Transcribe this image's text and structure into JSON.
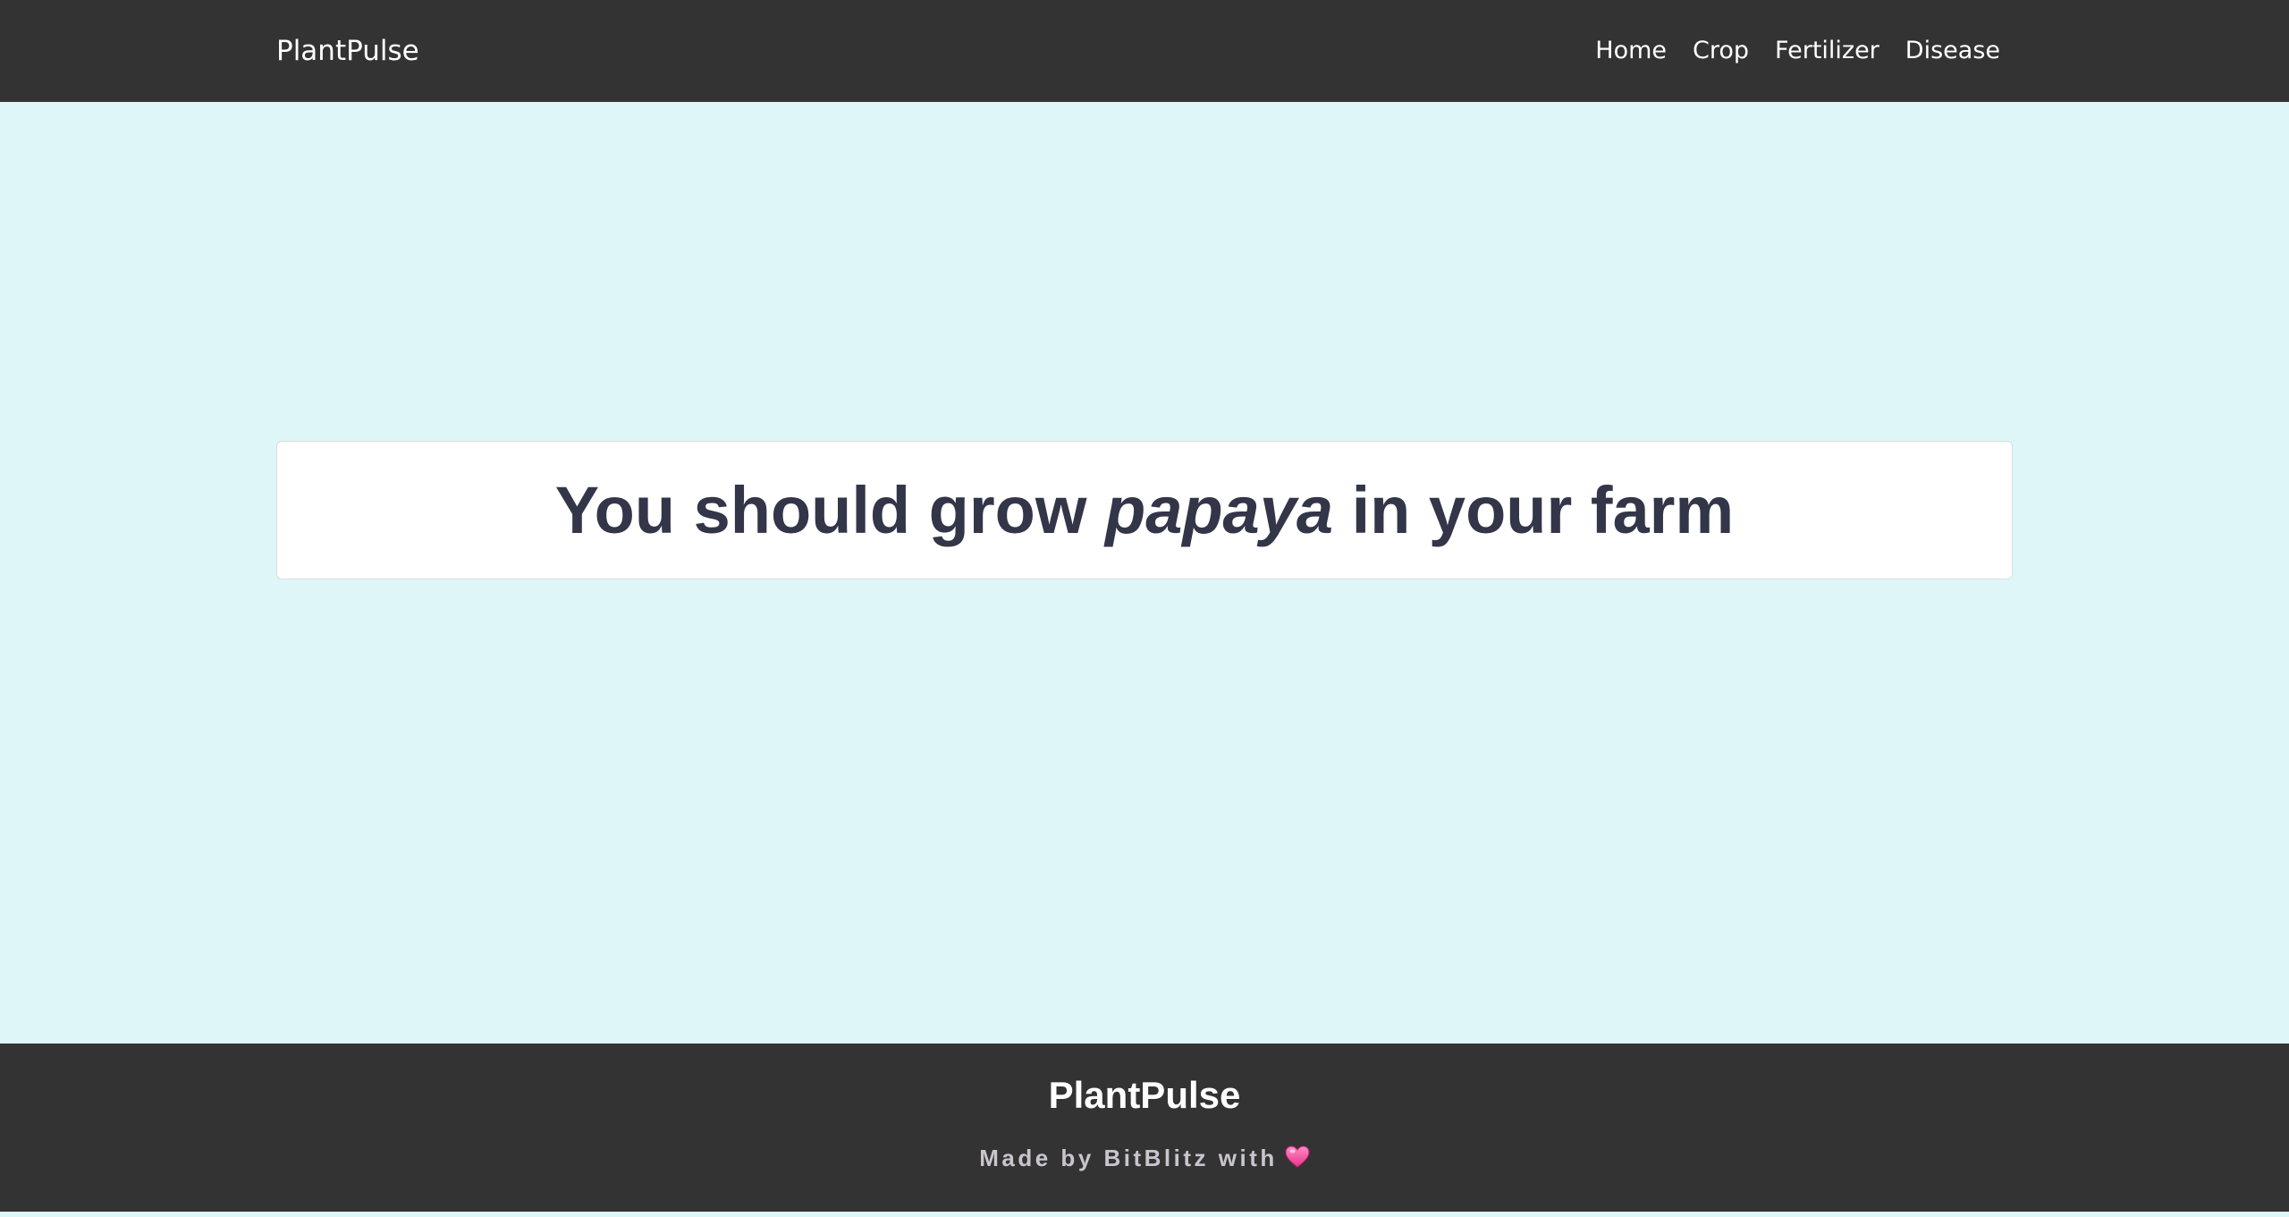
{
  "navbar": {
    "brand": "PlantPulse",
    "links": [
      {
        "label": "Home"
      },
      {
        "label": "Crop"
      },
      {
        "label": "Fertilizer"
      },
      {
        "label": "Disease"
      }
    ]
  },
  "result": {
    "prefix": "You should grow ",
    "crop": "papaya",
    "suffix": " in your farm"
  },
  "footer": {
    "brand": "PlantPulse",
    "credit": "Made by BitBlitz with",
    "heart_icon": "heart-icon"
  },
  "colors": {
    "navbar_bg": "#333333",
    "page_bg": "#dff6f8",
    "result_text": "#333548",
    "heart": "#ff5fa2"
  }
}
